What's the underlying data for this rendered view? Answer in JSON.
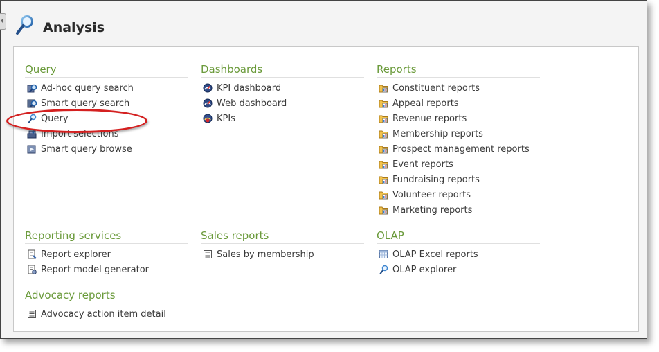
{
  "header": {
    "title": "Analysis"
  },
  "sections": {
    "query": {
      "title": "Query",
      "items": [
        {
          "label": "Ad-hoc query search",
          "icon": "adhoc-query-icon"
        },
        {
          "label": "Smart query search",
          "icon": "smart-query-icon"
        },
        {
          "label": "Query",
          "icon": "magnifier-icon"
        },
        {
          "label": "Import selections",
          "icon": "import-icon"
        },
        {
          "label": "Smart query browse",
          "icon": "browse-icon"
        }
      ]
    },
    "dashboards": {
      "title": "Dashboards",
      "items": [
        {
          "label": "KPI dashboard",
          "icon": "dashboard-gauge-icon"
        },
        {
          "label": "Web dashboard",
          "icon": "dashboard-gauge-icon"
        },
        {
          "label": "KPIs",
          "icon": "kpi-gauge-icon"
        }
      ]
    },
    "reports": {
      "title": "Reports",
      "items": [
        {
          "label": "Constituent reports",
          "icon": "folder-report-icon"
        },
        {
          "label": "Appeal reports",
          "icon": "folder-report-icon"
        },
        {
          "label": "Revenue reports",
          "icon": "folder-report-icon"
        },
        {
          "label": "Membership reports",
          "icon": "folder-report-icon"
        },
        {
          "label": "Prospect management reports",
          "icon": "folder-report-icon"
        },
        {
          "label": "Event reports",
          "icon": "folder-report-icon"
        },
        {
          "label": "Fundraising reports",
          "icon": "folder-report-icon"
        },
        {
          "label": "Volunteer reports",
          "icon": "folder-report-icon"
        },
        {
          "label": "Marketing reports",
          "icon": "folder-report-icon"
        }
      ]
    },
    "reporting_services": {
      "title": "Reporting services",
      "items": [
        {
          "label": "Report explorer",
          "icon": "report-explorer-icon"
        },
        {
          "label": "Report model generator",
          "icon": "model-generator-icon"
        }
      ]
    },
    "sales_reports": {
      "title": "Sales reports",
      "items": [
        {
          "label": "Sales by membership",
          "icon": "document-list-icon"
        }
      ]
    },
    "olap": {
      "title": "OLAP",
      "items": [
        {
          "label": "OLAP Excel reports",
          "icon": "excel-sheet-icon"
        },
        {
          "label": "OLAP explorer",
          "icon": "magnifier-icon"
        }
      ]
    },
    "advocacy_reports": {
      "title": "Advocacy reports",
      "items": [
        {
          "label": "Advocacy action item detail",
          "icon": "document-list-icon"
        }
      ]
    }
  },
  "highlight": {
    "color": "#d42020",
    "target": "Query"
  },
  "colors": {
    "section_title": "#6a9a3a",
    "link_text": "#3a3a3a"
  }
}
